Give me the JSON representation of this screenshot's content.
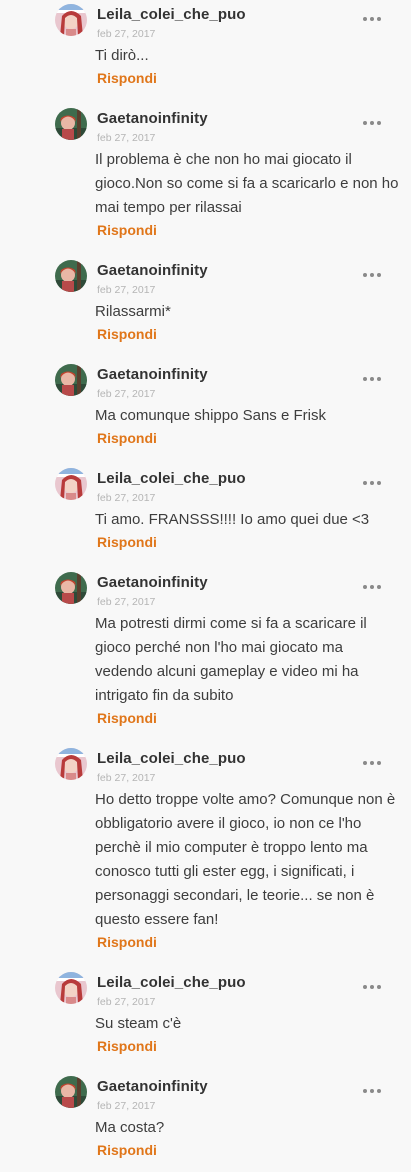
{
  "comments": [
    {
      "author": "Leila_colei_che_puo",
      "date": "feb 27, 2017",
      "text": "Ti dirò...",
      "reply": "Rispondi",
      "avatar": "anime-girl-avatar",
      "more_icon": "more-options-icon"
    },
    {
      "author": "Gaetanoinfinity",
      "date": "feb 27, 2017",
      "text": "Il problema è che non ho mai giocato il gioco.Non so come si fa a scaricarlo e non ho mai tempo per rilassai",
      "reply": "Rispondi",
      "avatar": "character-green-avatar",
      "more_icon": "more-options-icon"
    },
    {
      "author": "Gaetanoinfinity",
      "date": "feb 27, 2017",
      "text": "Rilassarmi*",
      "reply": "Rispondi",
      "avatar": "character-green-avatar",
      "more_icon": "more-options-icon"
    },
    {
      "author": "Gaetanoinfinity",
      "date": "feb 27, 2017",
      "text": "Ma comunque shippo Sans e Frisk",
      "reply": "Rispondi",
      "avatar": "character-green-avatar",
      "more_icon": "more-options-icon"
    },
    {
      "author": "Leila_colei_che_puo",
      "date": "feb 27, 2017",
      "text": "Ti amo. FRANSSS!!!! Io amo quei due <3",
      "reply": "Rispondi",
      "avatar": "anime-girl-avatar",
      "more_icon": "more-options-icon"
    },
    {
      "author": "Gaetanoinfinity",
      "date": "feb 27, 2017",
      "text": "Ma potresti dirmi come si fa a scaricare il gioco perché non l'ho mai giocato ma vedendo alcuni gameplay e video mi ha intrigato fin da subito",
      "reply": "Rispondi",
      "avatar": "character-green-avatar",
      "more_icon": "more-options-icon"
    },
    {
      "author": "Leila_colei_che_puo",
      "date": "feb 27, 2017",
      "text": "Ho detto troppe volte amo? Comunque non è obbligatorio avere il gioco, io non ce l'ho perchè il mio computer è troppo lento ma conosco tutti gli ester egg, i significati, i personaggi secondari, le teorie... se non è questo essere fan!",
      "reply": "Rispondi",
      "avatar": "anime-girl-avatar",
      "more_icon": "more-options-icon"
    },
    {
      "author": "Leila_colei_che_puo",
      "date": "feb 27, 2017",
      "text": "Su steam c'è",
      "reply": "Rispondi",
      "avatar": "anime-girl-avatar",
      "more_icon": "more-options-icon"
    },
    {
      "author": "Gaetanoinfinity",
      "date": "feb 27, 2017",
      "text": "Ma costa?",
      "reply": "Rispondi",
      "avatar": "character-green-avatar",
      "more_icon": "more-options-icon"
    }
  ],
  "colors": {
    "background": "#f8f8f8",
    "reply": "#e0761a",
    "date": "#b5b5b5",
    "author": "#333333"
  }
}
